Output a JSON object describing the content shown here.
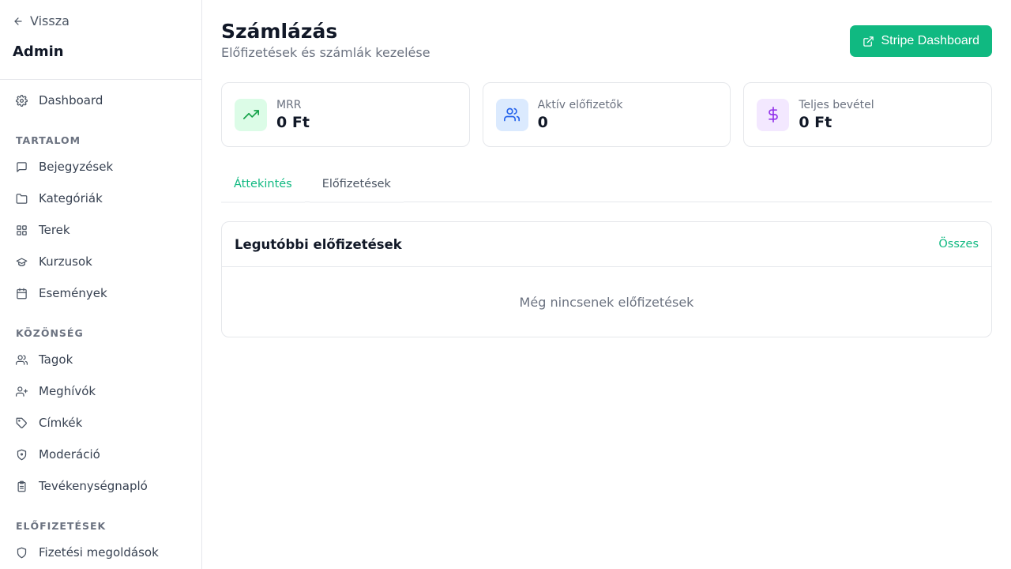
{
  "sidebar": {
    "back_label": "Vissza",
    "title": "Admin",
    "dashboard_label": "Dashboard",
    "sections": [
      {
        "label": "TARTALOM",
        "items": [
          "Bejegyzések",
          "Kategóriák",
          "Terek",
          "Kurzusok",
          "Események"
        ]
      },
      {
        "label": "KÖZÖNSÉG",
        "items": [
          "Tagok",
          "Meghívók",
          "Címkék",
          "Moderáció",
          "Tevékenységnapló"
        ]
      },
      {
        "label": "ELŐFIZETÉSEK",
        "items": [
          "Fizetési megoldások"
        ]
      }
    ]
  },
  "header": {
    "title": "Számlázás",
    "subtitle": "Előfizetések és számlák kezelése",
    "stripe_button": "Stripe Dashboard"
  },
  "stats": [
    {
      "label": "MRR",
      "value": "0 Ft",
      "icon": "trending-up-icon",
      "color": "#16a34a",
      "bg": "#dcfce7"
    },
    {
      "label": "Aktív előfizetők",
      "value": "0",
      "icon": "users-icon",
      "color": "#2563eb",
      "bg": "#dbeafe"
    },
    {
      "label": "Teljes bevétel",
      "value": "0 Ft",
      "icon": "dollar-icon",
      "color": "#9333ea",
      "bg": "#f3e8ff"
    }
  ],
  "tabs": [
    {
      "label": "Áttekintés",
      "active": true
    },
    {
      "label": "Előfizetések",
      "active": false
    }
  ],
  "recent": {
    "title": "Legutóbbi előfizetések",
    "all_link": "Összes",
    "empty_text": "Még nincsenek előfizetések"
  },
  "colors": {
    "accent": "#10b981"
  }
}
